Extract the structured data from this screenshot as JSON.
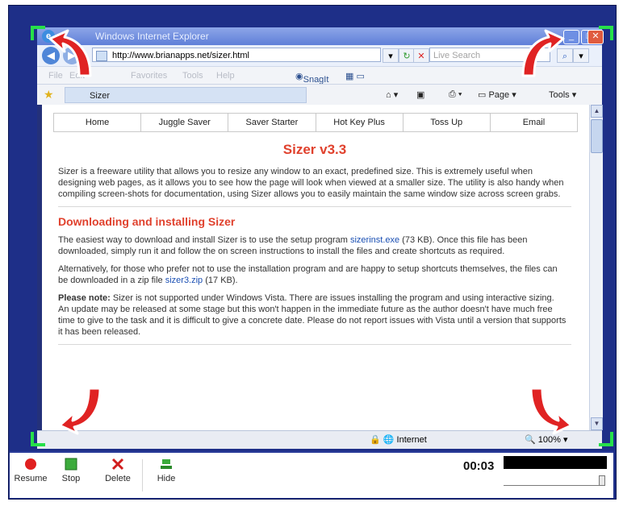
{
  "browser": {
    "title": "Windows Internet Explorer",
    "address": "http://www.brianapps.net/sizer.html",
    "search_placeholder": "Live Search",
    "menu": [
      "File",
      "Edit",
      "Favorites",
      "Tools",
      "Help"
    ],
    "snagit_label": "SnagIt",
    "tab_title": "Sizer",
    "page_button": "Page",
    "tools_button": "Tools",
    "status_zone": "Internet",
    "zoom": "100%"
  },
  "page": {
    "nav": [
      "Home",
      "Juggle Saver",
      "Saver Starter",
      "Hot Key Plus",
      "Toss Up",
      "Email"
    ],
    "title": "Sizer v3.3",
    "intro": "Sizer is a freeware utility that allows you to resize any window to an exact, predefined size. This is extremely useful when designing web pages, as it allows you to see how the page will look when viewed at a smaller size. The utility is also handy when compiling screen-shots for documentation, using Sizer allows you to easily maintain the same window size across screen grabs.",
    "section1_heading": "Downloading and installing Sizer",
    "p1_before": "The easiest way to download and install Sizer is to use the setup program ",
    "p1_link": "sizerinst.exe",
    "p1_after": " (73 KB). Once this file has been downloaded, simply run it and follow the on screen instructions to install the files and create shortcuts as required.",
    "p2_before": "Alternatively, for those who prefer not to use the installation program and are happy to setup shortcuts themselves, the files can be downloaded in a zip file ",
    "p2_link": "sizer3.zip",
    "p2_after": " (17 KB).",
    "note_label": "Please note:",
    "note_text": " Sizer is not supported under Windows Vista. There are issues installing the program and using interactive sizing. An update may be released at some stage but this won't happen in the immediate future as the author doesn't have much free time to give to the task and it is difficult to give a concrete date. Please do not report issues with Vista until a version that supports it has been released."
  },
  "recorder": {
    "buttons": [
      "Resume",
      "Stop",
      "Delete",
      "Hide"
    ],
    "time": "00:03"
  },
  "colors": {
    "frame_blue": "#1e2f88",
    "corner_green": "#27e04a",
    "title_red": "#e0412d",
    "arrow_red": "#e02323"
  }
}
